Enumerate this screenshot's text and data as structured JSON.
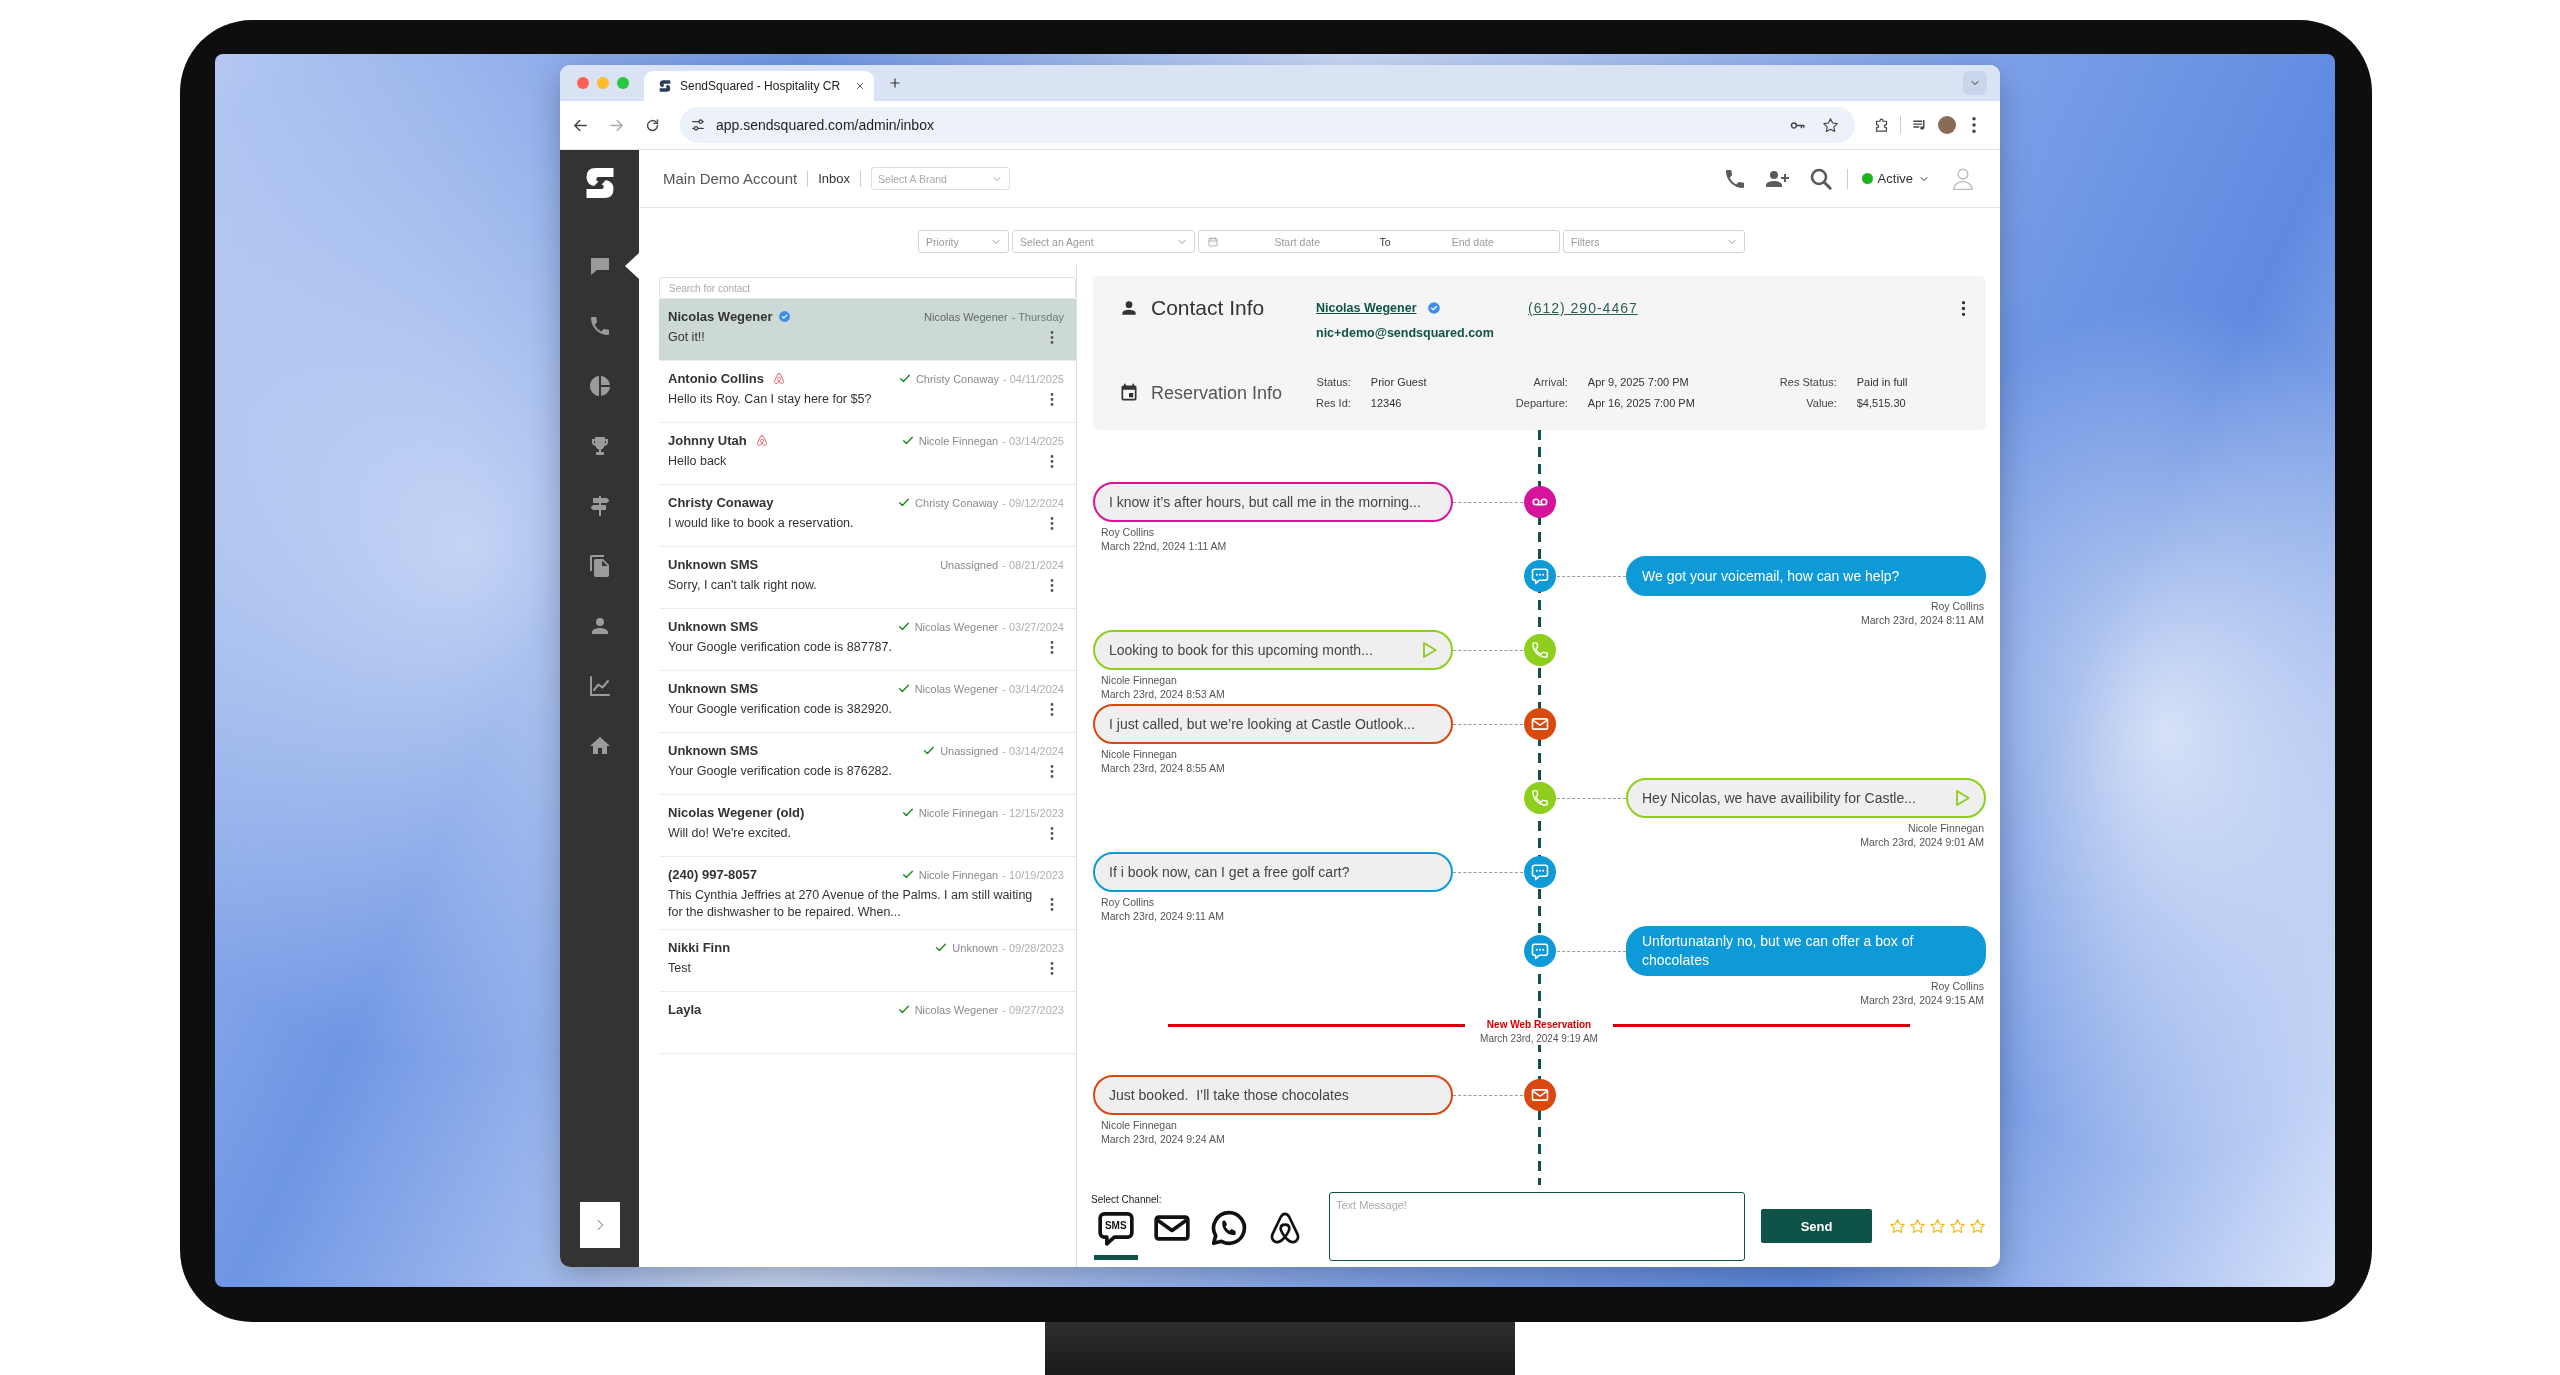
{
  "browser": {
    "tab_title": "SendSquared - Hospitality CR",
    "url": "app.sendsquared.com/admin/inbox"
  },
  "sidebar": {
    "items": [
      {
        "kind": "chat",
        "selected": true
      },
      {
        "kind": "phone",
        "selected": false
      },
      {
        "kind": "pie",
        "selected": false
      },
      {
        "kind": "trophy",
        "selected": false
      },
      {
        "kind": "signpost",
        "selected": false
      },
      {
        "kind": "copy",
        "selected": false
      },
      {
        "kind": "person",
        "selected": false
      },
      {
        "kind": "chart",
        "selected": false
      },
      {
        "kind": "home",
        "selected": false
      }
    ]
  },
  "header": {
    "account": "Main Demo Account",
    "section": "Inbox",
    "brand_select": {
      "placeholder": "Select A Brand"
    },
    "status": "Active"
  },
  "filters": [
    {
      "kind": "select",
      "placeholder": "Priority"
    },
    {
      "kind": "select",
      "placeholder": "Select an Agent"
    },
    {
      "kind": "date_range",
      "start": {
        "placeholder": "Start date"
      },
      "separator": "To",
      "end": {
        "placeholder": "End date"
      }
    },
    {
      "kind": "select",
      "placeholder": "Filters"
    }
  ],
  "contacts": {
    "search": {
      "placeholder": "Search for contact"
    },
    "items": [
      {
        "name": "Nicolas Wegener",
        "verified": true,
        "listing": false,
        "done": false,
        "agent": "Nicolas Wegener",
        "date": "- Thursday",
        "message": "Got it!!",
        "selected": true
      },
      {
        "name": "Antonio Collins",
        "verified": false,
        "listing": true,
        "done": true,
        "agent": "Christy Conaway",
        "date": "- 04/11/2025",
        "message": "Hello its Roy. Can I stay here for $5?",
        "selected": false
      },
      {
        "name": "Johnny Utah",
        "verified": false,
        "listing": true,
        "done": true,
        "agent": "Nicole Finnegan",
        "date": "- 03/14/2025",
        "message": "Hello back",
        "selected": false
      },
      {
        "name": "Christy Conaway",
        "verified": false,
        "listing": false,
        "done": true,
        "agent": "Christy Conaway",
        "date": "- 09/12/2024",
        "message": "I would like to book a reservation.",
        "selected": false
      },
      {
        "name": "Unknown SMS",
        "verified": false,
        "listing": false,
        "done": false,
        "agent": "Unassigned",
        "date": "- 08/21/2024",
        "message": "Sorry, I can't talk right now.",
        "selected": false
      },
      {
        "name": "Unknown SMS",
        "verified": false,
        "listing": false,
        "done": true,
        "agent": "Nicolas Wegener",
        "date": "- 03/27/2024",
        "message": "Your Google verification code is 887787.",
        "selected": false
      },
      {
        "name": "Unknown SMS",
        "verified": false,
        "listing": false,
        "done": true,
        "agent": "Nicolas Wegener",
        "date": "- 03/14/2024",
        "message": "Your Google verification code is 382920.",
        "selected": false
      },
      {
        "name": "Unknown SMS",
        "verified": false,
        "listing": false,
        "done": true,
        "agent": "Unassigned",
        "date": "- 03/14/2024",
        "message": "Your Google verification code is 876282.",
        "selected": false
      },
      {
        "name": "Nicolas Wegener (old)",
        "verified": false,
        "listing": false,
        "done": true,
        "agent": "Nicole Finnegan",
        "date": "- 12/15/2023",
        "message": "Will do! We're excited.",
        "selected": false
      },
      {
        "name": "(240) 997-8057",
        "verified": false,
        "listing": false,
        "done": true,
        "agent": "Nicole Finnegan",
        "date": "- 10/19/2023",
        "message": "This Cynthia Jeffries at 270 Avenue of the Palms. I am still waiting for the dishwasher to be repaired. When...",
        "selected": false
      },
      {
        "name": "Nikki Finn",
        "verified": false,
        "listing": false,
        "done": true,
        "agent": "Unknown",
        "date": "- 09/28/2023",
        "message": "Test",
        "selected": false
      },
      {
        "name": "Layla",
        "verified": false,
        "listing": false,
        "done": true,
        "agent": "Nicolas Wegener",
        "date": "- 09/27/2023",
        "selected": false
      }
    ]
  },
  "contact_info": {
    "title": "Contact Info",
    "name": "Nicolas Wegener",
    "verified": true,
    "phone": "(612) 290-4467",
    "email": "nic+demo@sendsquared.com"
  },
  "reservation_info": {
    "title": "Reservation Info",
    "fields": [
      {
        "label": "Status:",
        "value": "Prior Guest"
      },
      {
        "label": "Arrival:",
        "value": "Apr 9, 2025 7:00 PM"
      },
      {
        "label": "Res Status:",
        "value": "Paid in full"
      },
      {
        "label": "Res Id:",
        "value": "12346"
      },
      {
        "label": "Departure:",
        "value": "Apr 16, 2025 7:00 PM"
      },
      {
        "label": "Value:",
        "value": "$4,515.30"
      }
    ]
  },
  "timeline": [
    {
      "kind": "voicemail_in",
      "text": "I know it’s after hours, but call me in the morning...",
      "author": "Roy Collins",
      "time": "March 22nd, 2024 1:11 AM"
    },
    {
      "kind": "sms_out",
      "text": "We got your voicemail, how can we help?",
      "author": "Roy Collins",
      "time": "March 23rd, 2024 8:11 AM"
    },
    {
      "kind": "call_in",
      "text": "Looking to book for this upcoming month...",
      "author": "Nicole Finnegan",
      "time": "March 23rd, 2024 8:53 AM"
    },
    {
      "kind": "email_in",
      "text": "I just called, but we’re looking at Castle Outlook...",
      "author": "Nicole Finnegan",
      "time": "March 23rd, 2024 8:55 AM"
    },
    {
      "kind": "call_out",
      "text": "Hey Nicolas, we have availibility for Castle...",
      "author": "Nicole Finnegan",
      "time": "March 23rd, 2024 9:01 AM"
    },
    {
      "kind": "sms_in",
      "text": "If i book now, can I get a free golf cart?",
      "author": "Roy Collins",
      "time": "March 23rd, 2024 9:11 AM"
    },
    {
      "kind": "sms_out",
      "text": "Unfortunatanly no, but we can offer a box of chocolates",
      "author": "Roy Collins",
      "time": "March 23rd, 2024 9:15 AM"
    },
    {
      "kind": "divider",
      "title": "New Web Reservation",
      "time": "March 23rd, 2024 9:19 AM"
    },
    {
      "kind": "email_in",
      "text": "Just booked.  I’ll take those chocolates",
      "author": "Nicole Finnegan",
      "time": "March 23rd, 2024 9:24 AM"
    }
  ],
  "composer": {
    "label": "Select Channel:",
    "channels": [
      {
        "kind": "sms",
        "label": "SMS",
        "selected": true
      },
      {
        "kind": "email",
        "selected": false
      },
      {
        "kind": "phone_chat",
        "selected": false
      },
      {
        "kind": "listing",
        "selected": false
      }
    ],
    "message": {
      "placeholder": "Text Message!"
    },
    "send": "Send",
    "stars": 0
  }
}
